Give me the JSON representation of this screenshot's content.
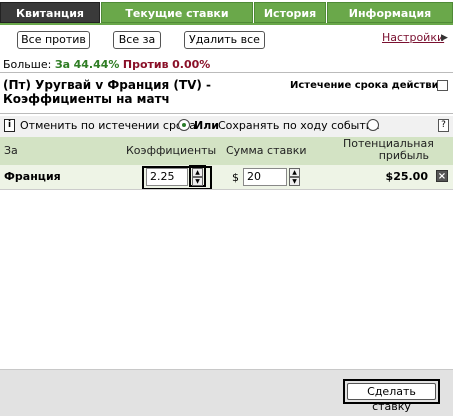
{
  "tabs": [
    {
      "label": "Квитанция",
      "active": true
    },
    {
      "label": "Текущие ставки",
      "active": false
    },
    {
      "label": "История",
      "active": false
    },
    {
      "label": "Информация",
      "active": false
    }
  ],
  "toolbar": {
    "all_against": "Все против",
    "all_for": "Все за",
    "remove_all": "Удалить все",
    "settings": "Настройки"
  },
  "stats": {
    "more_label": "Больше:",
    "for_label": "За",
    "for_value": "44.44%",
    "against_label": "Против",
    "against_value": "0.00%"
  },
  "bet": {
    "title": "(Пт) Уругвай v Франция (TV) - Коэффициенты на матч",
    "expiry_label": "Истечение срока действия:",
    "expiry_checked": false
  },
  "options": {
    "cancel_label": "Отменить по истечении срока",
    "or_label": "Или",
    "keep_label": "Сохранять по ходу события",
    "selected": "cancel",
    "help": "?"
  },
  "table": {
    "col_for": "За",
    "col_odds": "Коэффициенты",
    "col_stake": "Сумма ставки",
    "col_profit": "Потенциальная прибыль",
    "row": {
      "selection": "Франция",
      "odds": "2.25",
      "currency": "$",
      "stake": "20",
      "profit": "$25.00"
    }
  },
  "footer": {
    "submit": "Сделать ставку"
  },
  "colors": {
    "tab_green": "#6aa84a",
    "tab_active": "#3a3a3a",
    "header_green": "#d3e3c4",
    "row_green": "#eef4e6",
    "positive": "#2f7d24",
    "negative": "#8a1028"
  }
}
